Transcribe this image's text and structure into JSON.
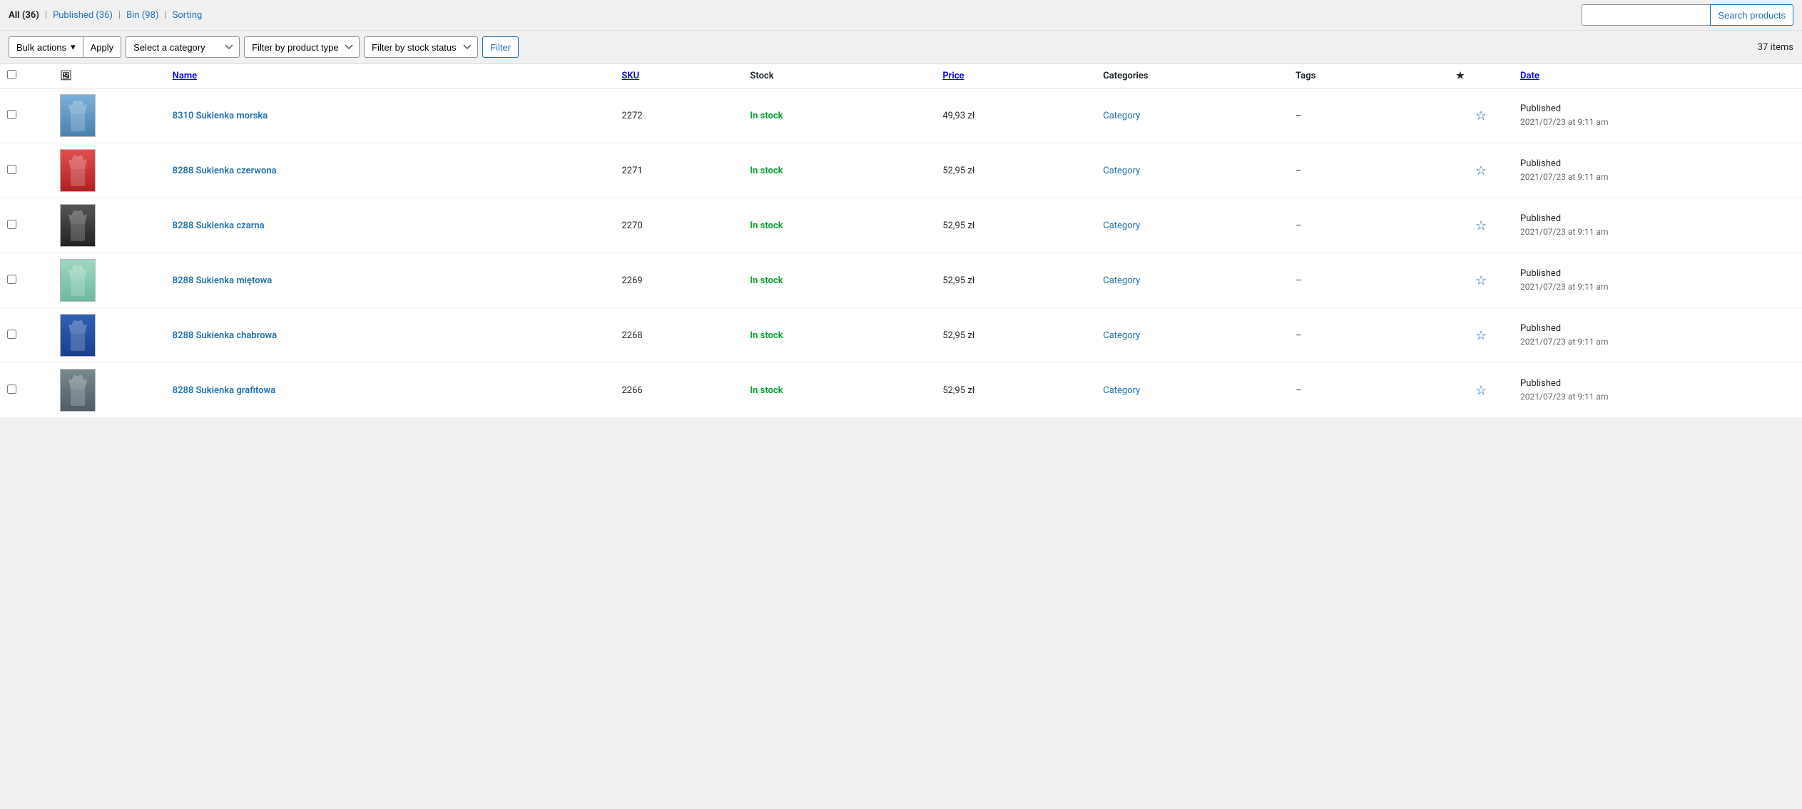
{
  "topbar": {
    "filters": [
      {
        "label": "All",
        "count": "36",
        "active": true
      },
      {
        "label": "Published",
        "count": "36",
        "active": false
      },
      {
        "label": "Bin",
        "count": "98",
        "active": false
      },
      {
        "label": "Sorting",
        "count": null,
        "active": false
      }
    ]
  },
  "search": {
    "placeholder": "",
    "button_label": "Search products"
  },
  "toolbar": {
    "bulk_actions_label": "Bulk actions",
    "apply_label": "Apply",
    "category_placeholder": "Select a category",
    "product_type_placeholder": "Filter by product type",
    "stock_status_placeholder": "Filter by stock status",
    "filter_label": "Filter",
    "items_count": "37 items"
  },
  "table": {
    "columns": [
      {
        "key": "cb",
        "label": ""
      },
      {
        "key": "img",
        "label": ""
      },
      {
        "key": "name",
        "label": "Name",
        "sortable": true
      },
      {
        "key": "sku",
        "label": "SKU",
        "sortable": true
      },
      {
        "key": "stock",
        "label": "Stock"
      },
      {
        "key": "price",
        "label": "Price",
        "sortable": true
      },
      {
        "key": "categories",
        "label": "Categories"
      },
      {
        "key": "tags",
        "label": "Tags"
      },
      {
        "key": "star",
        "label": "★"
      },
      {
        "key": "date",
        "label": "Date",
        "sortable": true
      }
    ],
    "rows": [
      {
        "name": "8310 Sukienka morska",
        "sku": "2272",
        "stock": "In stock",
        "price": "49,93 zł",
        "category": "Category",
        "tags": "–",
        "starred": false,
        "status": "Published",
        "date": "2021/07/23 at 9:11 am",
        "img_color": "blue"
      },
      {
        "name": "8288 Sukienka czerwona",
        "sku": "2271",
        "stock": "In stock",
        "price": "52,95 zł",
        "category": "Category",
        "tags": "–",
        "starred": false,
        "status": "Published",
        "date": "2021/07/23 at 9:11 am",
        "img_color": "red"
      },
      {
        "name": "8288 Sukienka czarna",
        "sku": "2270",
        "stock": "In stock",
        "price": "52,95 zł",
        "category": "Category",
        "tags": "–",
        "starred": false,
        "status": "Published",
        "date": "2021/07/23 at 9:11 am",
        "img_color": "black"
      },
      {
        "name": "8288 Sukienka miętowa",
        "sku": "2269",
        "stock": "In stock",
        "price": "52,95 zł",
        "category": "Category",
        "tags": "–",
        "starred": false,
        "status": "Published",
        "date": "2021/07/23 at 9:11 am",
        "img_color": "mint"
      },
      {
        "name": "8288 Sukienka chabrowa",
        "sku": "2268",
        "stock": "In stock",
        "price": "52,95 zł",
        "category": "Category",
        "tags": "–",
        "starred": false,
        "status": "Published",
        "date": "2021/07/23 at 9:11 am",
        "img_color": "blue2"
      },
      {
        "name": "8288 Sukienka grafitowa",
        "sku": "2266",
        "stock": "In stock",
        "price": "52,95 zł",
        "category": "Category",
        "tags": "–",
        "starred": false,
        "status": "Published",
        "date": "2021/07/23 at 9:11 am",
        "img_color": "gray"
      }
    ]
  }
}
